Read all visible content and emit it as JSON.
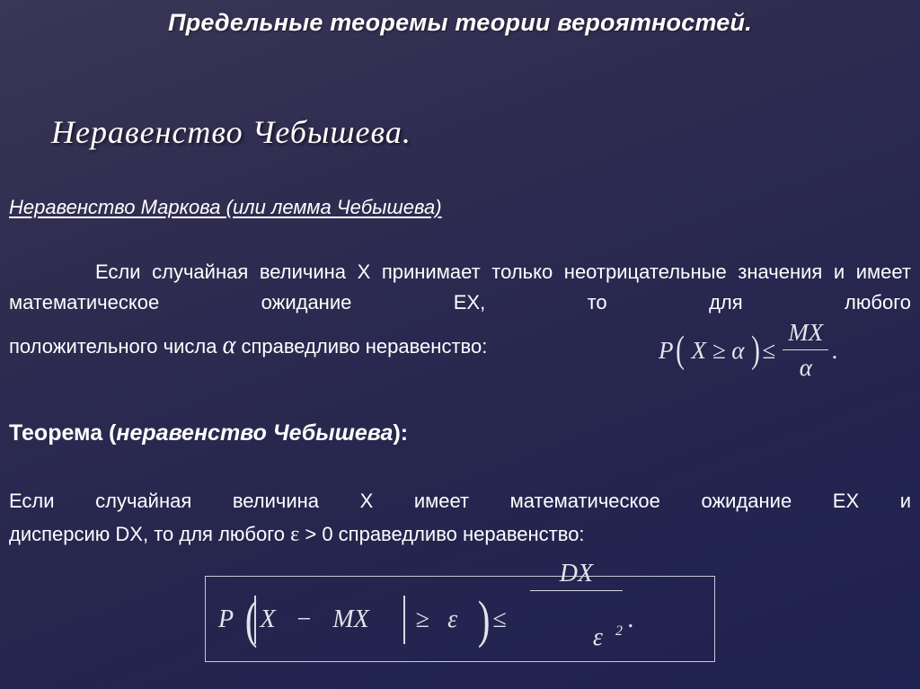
{
  "slide": {
    "title": "Предельные теоремы теории вероятностей.",
    "subtitle": "Неравенство Чебышева.",
    "markov": {
      "heading": "Неравенство Маркова (или лемма Чебышева)",
      "paragraph": "Если случайная величина X принимает только неотрицательные значения и имеет математическое ожидание EX, то для любого",
      "last_line_before": "положительного числа",
      "alpha_symbol": "α",
      "last_line_after": "справедливо неравенство:",
      "formula": {
        "P": "P",
        "open_paren": "(",
        "inner": "X ≥ α",
        "close_paren": ")",
        "le": "≤",
        "numerator": "MX",
        "denominator": "α",
        "period": "."
      }
    },
    "theorem": {
      "label_prefix": "Теорема (",
      "label_italic": "неравенство Чебышева",
      "label_suffix": "):",
      "paragraph": "Если случайная величина X имеет математическое ожидание EX и",
      "last_line_before": "дисперсию DX, то для любого",
      "epsilon_symbol": "ε",
      "last_line_after": "> 0 справедливо неравенство:",
      "formula": {
        "P": "P",
        "open_paren": "(",
        "X": "X",
        "minus": "−",
        "MX": "MX",
        "ge": "≥",
        "eps": "ε",
        "close_paren": ")",
        "le": "≤",
        "numerator": "DX",
        "denominator": "ε",
        "exponent": "2",
        "period": "."
      }
    }
  },
  "colors": {
    "background_top": "#3a3656",
    "background_bottom": "#1f2150",
    "text": "#ffffff",
    "formula_text": "#e4e4ec",
    "box_border": "#c9c9d8"
  }
}
